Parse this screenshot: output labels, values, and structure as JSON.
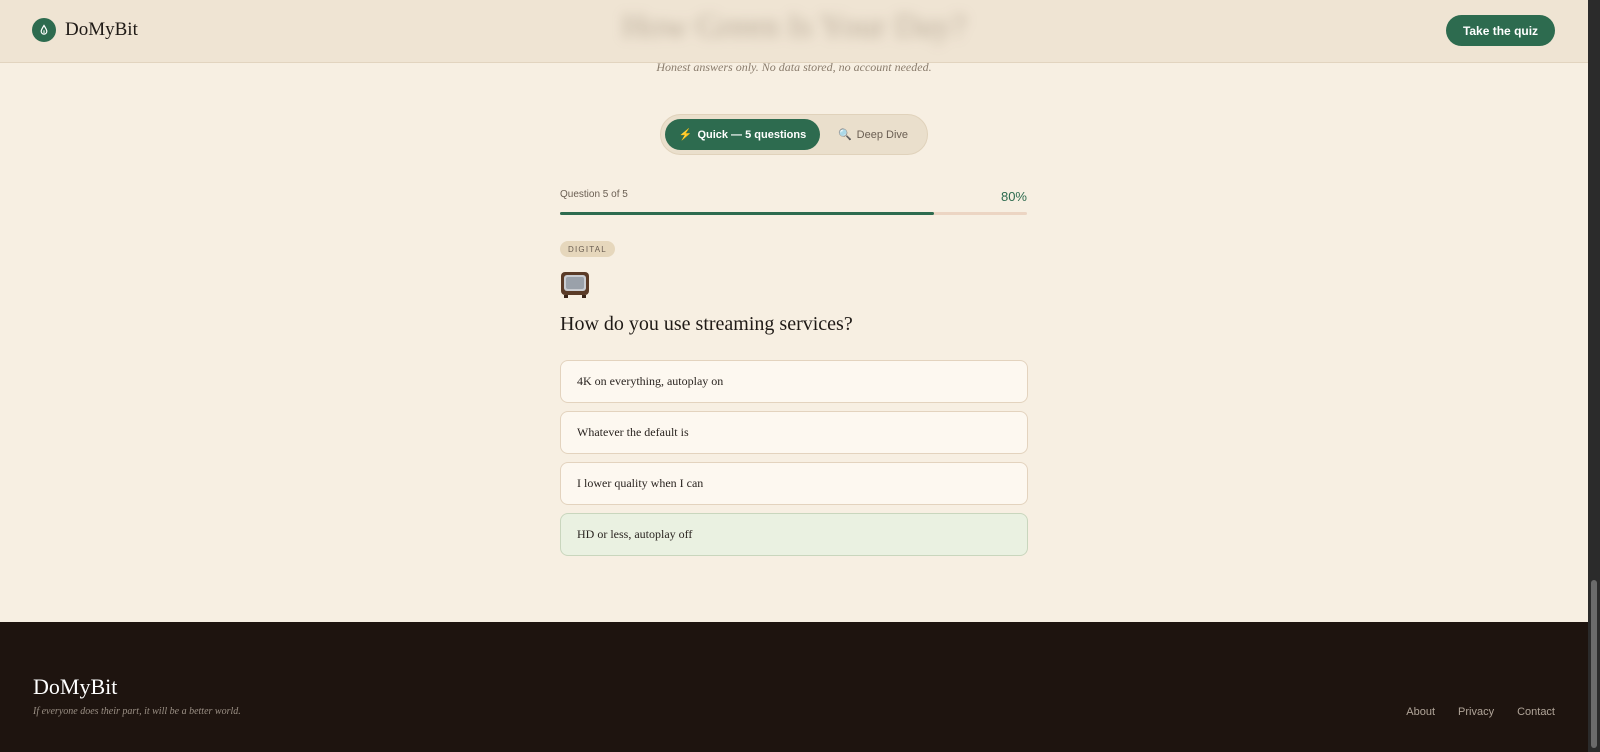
{
  "header": {
    "brand": "DoMyBit",
    "cta_label": "Take the quiz",
    "blurred_title": "How Green Is Your Day?"
  },
  "subtitle": "Honest answers only. No data stored, no account needed.",
  "mode_toggle": {
    "options": [
      {
        "icon": "⚡",
        "label": "Quick — 5 questions",
        "active": true
      },
      {
        "icon": "🔍",
        "label": "Deep Dive",
        "active": false
      }
    ]
  },
  "progress": {
    "label": "Question 5 of 5",
    "percent_label": "80%",
    "fraction": 0.8
  },
  "question": {
    "category": "DIGITAL",
    "icon": "tv-icon",
    "text": "How do you use streaming services?",
    "answers": [
      {
        "label": "4K on everything, autoplay on",
        "selected": false
      },
      {
        "label": "Whatever the default is",
        "selected": false
      },
      {
        "label": "I lower quality when I can",
        "selected": false
      },
      {
        "label": "HD or less, autoplay off",
        "selected": true
      }
    ]
  },
  "footer": {
    "brand": "DoMyBit",
    "tagline": "If everyone does their part, it will be a better world.",
    "links": [
      "About",
      "Privacy",
      "Contact"
    ]
  },
  "colors": {
    "accent": "#2d6b4f",
    "background": "#f7efe2",
    "footer": "#1e140f",
    "selected_answer": "#eaf1e1"
  }
}
